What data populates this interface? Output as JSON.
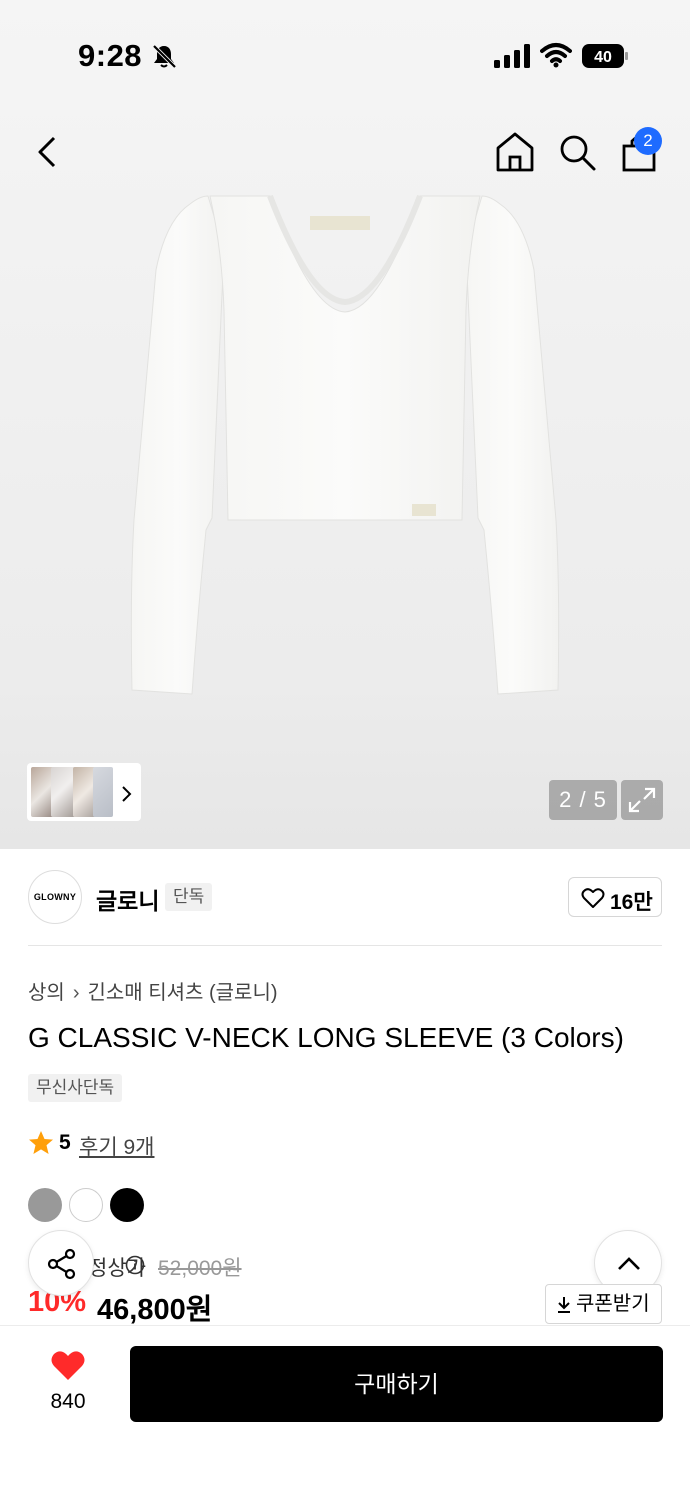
{
  "status_bar": {
    "time": "9:28",
    "battery": "40"
  },
  "nav": {
    "cart_count": "2"
  },
  "gallery": {
    "pager": "2 / 5"
  },
  "brand": {
    "logo_text": "GLOWNY",
    "name": "글로니",
    "tag": "단독",
    "like_count": "16만"
  },
  "product": {
    "breadcrumb": [
      "상의",
      "긴소매 티셔츠 (글로니)"
    ],
    "title": "G CLASSIC V-NECK LONG SLEEVE (3 Colors)",
    "exclusive_tag": "무신사단독",
    "rating": "5",
    "review_link": "후기 9개",
    "colors": [
      "#999999",
      "#ffffff",
      "#000000"
    ],
    "orig_label": "정상가",
    "orig_price": "52,000원",
    "discount": "10%",
    "price": "46,800원",
    "coupon": "쿠폰받기"
  },
  "bottom": {
    "wish_count": "840",
    "buy_label": "구매하기"
  }
}
